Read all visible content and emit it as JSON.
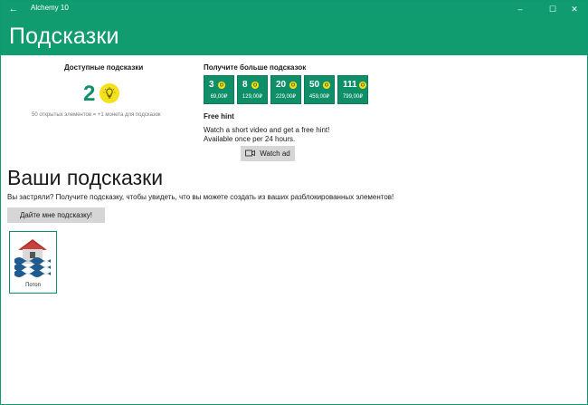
{
  "window": {
    "app_title": "Alchemy 10",
    "back_glyph": "←",
    "minimize_glyph": "–",
    "maximize_glyph": "☐",
    "close_glyph": "✕"
  },
  "header": {
    "title": "Подсказки"
  },
  "available": {
    "title": "Доступные подсказки",
    "count": "2",
    "note": "50 открытых элементов = +1 монета для подсказок"
  },
  "get_more": {
    "title": "Получите больше подсказок",
    "packs": [
      {
        "amount": "3",
        "price": "69,00₽"
      },
      {
        "amount": "8",
        "price": "129,00₽"
      },
      {
        "amount": "20",
        "price": "229,00₽"
      },
      {
        "amount": "50",
        "price": "459,00₽"
      },
      {
        "amount": "111",
        "price": "799,00₽"
      }
    ]
  },
  "free_hint": {
    "title": "Free hint",
    "line1": "Watch a short video and get a free hint!",
    "line2": "Available once per 24 hours.",
    "button_label": "Watch ad"
  },
  "your_hints": {
    "title": "Ваши подсказки",
    "subtitle": "Вы застряли? Получите подсказку, чтобы увидеть, что вы можете создать из ваших разблокированных элементов!",
    "button_label": "Дайте мне подсказку!",
    "items": [
      {
        "label": "Потоп",
        "icon": "flood-icon"
      }
    ]
  },
  "colors": {
    "accent": "#109c6f",
    "coin": "#f3e21a",
    "button": "#d6d6d6"
  }
}
